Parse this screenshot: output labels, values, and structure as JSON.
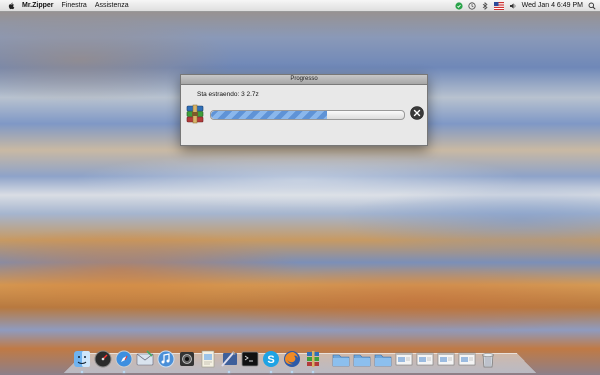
{
  "menubar": {
    "app_name": "Mr.Zipper",
    "menus": [
      "Finestra",
      "Assistenza"
    ],
    "clock": "Wed Jan 4  6:49 PM"
  },
  "dialog": {
    "title": "Progresso",
    "status_text": "Sta estraendo: 3 2.7z",
    "progress": 0.6
  },
  "dock": {
    "apps": [
      {
        "name": "finder-icon",
        "running": true
      },
      {
        "name": "dashboard-icon",
        "running": false
      },
      {
        "name": "safari-icon",
        "running": true
      },
      {
        "name": "mail-icon",
        "running": false
      },
      {
        "name": "itunes-icon",
        "running": false
      },
      {
        "name": "photobooth-icon",
        "running": false
      },
      {
        "name": "preview-icon",
        "running": false
      },
      {
        "name": "xcode-icon",
        "running": true
      },
      {
        "name": "terminal-icon",
        "running": false
      },
      {
        "name": "skype-icon",
        "running": true
      },
      {
        "name": "firefox-icon",
        "running": true
      },
      {
        "name": "winrar-icon",
        "running": true
      }
    ],
    "right": [
      {
        "name": "folder-icon"
      },
      {
        "name": "folder-icon"
      },
      {
        "name": "folder-icon"
      },
      {
        "name": "window-thumbnail-icon"
      },
      {
        "name": "window-thumbnail-icon"
      },
      {
        "name": "window-thumbnail-icon"
      },
      {
        "name": "window-thumbnail-icon"
      },
      {
        "name": "trash-icon"
      }
    ]
  }
}
